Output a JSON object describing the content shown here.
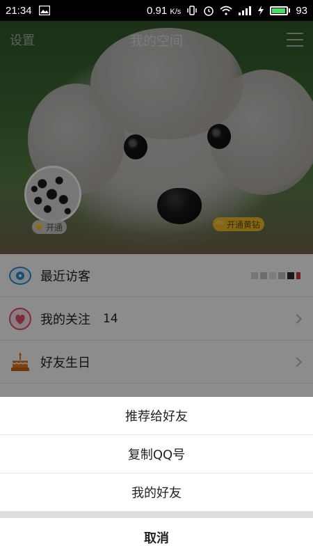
{
  "status_bar": {
    "time": "21:34",
    "network_speed": "0.91",
    "speed_unit": "K/s",
    "battery_level": "93",
    "battery_percent": 93,
    "icons": [
      "image-notification-icon",
      "vibrate-icon",
      "alarm-icon",
      "wifi-icon",
      "signal-icon",
      "charging-icon",
      "battery-icon"
    ]
  },
  "header": {
    "left_label": "设置",
    "title": "我的空间",
    "menu_icon": "menu-icon"
  },
  "profile": {
    "badge_open_label": "开通",
    "badge_yellow_label": "开通黄钻"
  },
  "list": {
    "items": [
      {
        "label": "最近访客",
        "icon": "eye-icon",
        "count": ""
      },
      {
        "label": "我的关注",
        "icon": "heart-icon",
        "count": "14"
      },
      {
        "label": "好友生日",
        "icon": "cake-icon",
        "count": ""
      }
    ]
  },
  "action_sheet": {
    "options": [
      "推荐给好友",
      "复制QQ号",
      "我的好友"
    ],
    "cancel_label": "取消"
  },
  "colors": {
    "accent_yellow": "#ffc428",
    "battery_green": "#4cd964",
    "eye_blue": "#2b8fd6",
    "heart_pink": "#e2506b",
    "cake_orange": "#e07a23"
  }
}
